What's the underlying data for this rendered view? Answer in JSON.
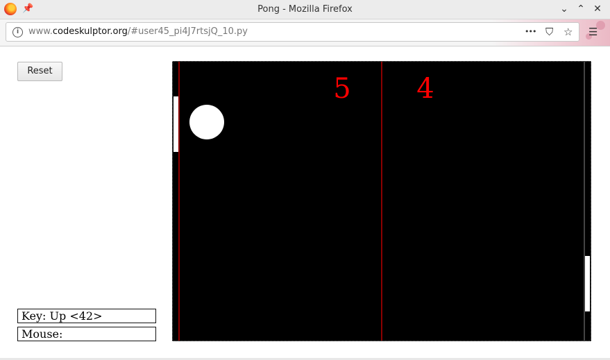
{
  "window": {
    "title": "Pong - Mozilla Firefox",
    "controls": [
      "⌄",
      "⌃",
      "✕"
    ]
  },
  "navbar": {
    "url_prefix": "www.",
    "url_domain": "codeskulptor.org",
    "url_path": "/#user45_pi4J7rtsjQ_10.py",
    "menu_glyphs": {
      "more": "•••",
      "pocket": "⛉",
      "bookmark": "☆",
      "hamburger": "☰"
    }
  },
  "controls": {
    "reset_label": "Reset",
    "key_status": "Key: Up <42>",
    "mouse_status": "Mouse:"
  },
  "game": {
    "score_left": "5",
    "score_right": "4",
    "colors": {
      "background": "#000000",
      "gutter_line": "#8b0000",
      "score": "#ff0000",
      "ball": "#ffffff",
      "paddle": "#ffffff"
    }
  }
}
